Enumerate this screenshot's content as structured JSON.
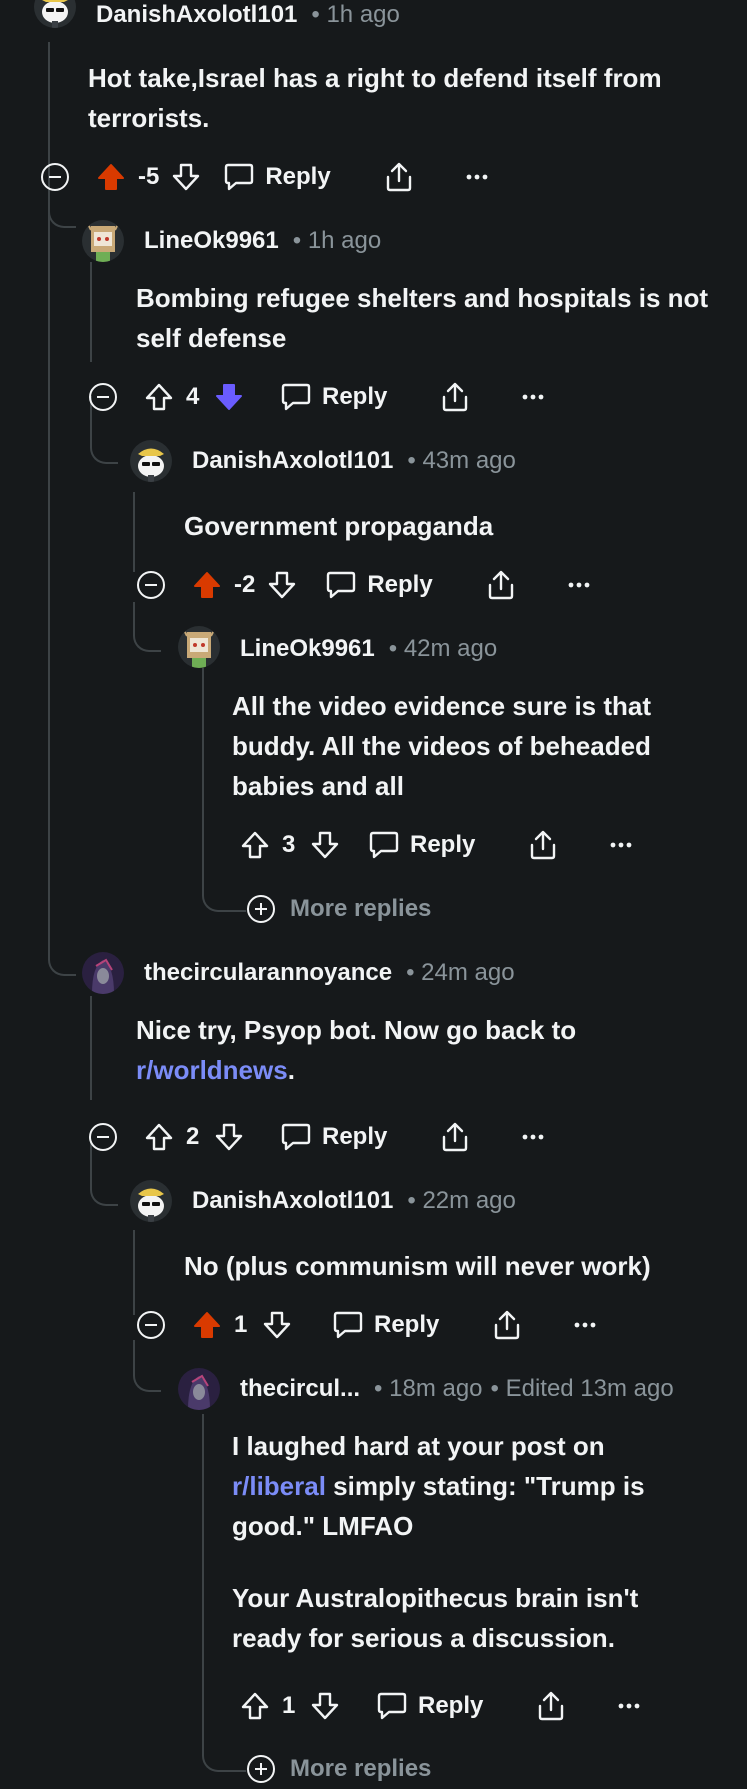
{
  "colors": {
    "background": "#16191b",
    "text": "#f2f4f5",
    "muted": "#8a949a",
    "link": "#7b8cf7",
    "upvote": "#d93a00",
    "downvote": "#6a5cff",
    "thread_line": "#3d4346"
  },
  "reply_label": "Reply",
  "more_replies_label": "More replies",
  "comments": [
    {
      "user": "DanishAxolotl101",
      "time": "• 1h ago",
      "avatar": "axolotl-snoo-avatar",
      "body": [
        "Hot take,Israel has a right to defend itself from terrorists."
      ],
      "score": "-5",
      "vote": "up"
    },
    {
      "user": "LineOk9961",
      "time": "• 1h ago",
      "avatar": "box-snoo-avatar",
      "body": [
        "Bombing refugee shelters and hospitals is not self defense"
      ],
      "score": "4",
      "vote": "down"
    },
    {
      "user": "DanishAxolotl101",
      "time": "• 43m ago",
      "avatar": "axolotl-snoo-avatar",
      "body": [
        "Government propaganda"
      ],
      "score": "-2",
      "vote": "up"
    },
    {
      "user": "LineOk9961",
      "time": "• 42m ago",
      "avatar": "box-snoo-avatar",
      "body": [
        "All the video evidence sure is that buddy. All the videos of beheaded babies and all"
      ],
      "score": "3",
      "vote": "none"
    },
    {
      "user": "thecircularannoyance",
      "time": "• 24m ago",
      "avatar": "hooded-figure-avatar",
      "body_prefix": "Nice try, Psyop bot. Now go back to ",
      "body_link": "r/worldnews",
      "body_suffix": ".",
      "score": "2",
      "vote": "none"
    },
    {
      "user": "DanishAxolotl101",
      "time": "• 22m ago",
      "avatar": "axolotl-snoo-avatar",
      "body": [
        "No (plus communism will never work)"
      ],
      "score": "1",
      "vote": "up"
    },
    {
      "user": "thecircul...",
      "time": "• 18m ago",
      "edited": "• Edited 13m ago",
      "avatar": "hooded-figure-avatar",
      "body_p1_prefix": "I laughed hard at your post on ",
      "body_p1_link": "r/liberal",
      "body_p1_suffix": " simply stating: \"Trump is good.\" LMFAO",
      "body_p2": "Your Australopithecus brain isn't ready for serious a discussion.",
      "score": "1",
      "vote": "none"
    }
  ]
}
